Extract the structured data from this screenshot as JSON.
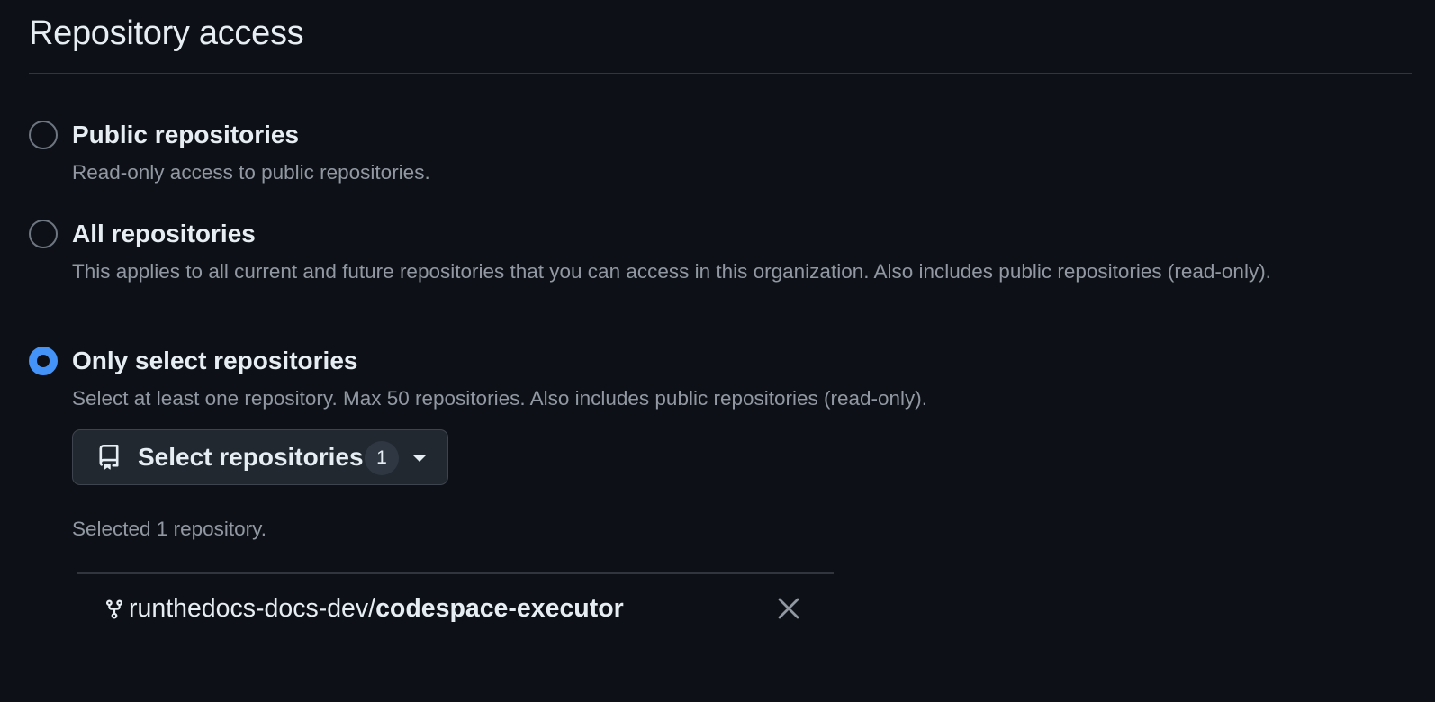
{
  "page": {
    "title": "Repository access"
  },
  "options": [
    {
      "label": "Public repositories",
      "description": "Read-only access to public repositories.",
      "checked": false
    },
    {
      "label": "All repositories",
      "description": "This applies to all current and future repositories that you can access in this organization. Also includes public repositories (read-only).",
      "checked": false
    },
    {
      "label": "Only select repositories",
      "description": "Select at least one repository. Max 50 repositories. Also includes public repositories (read-only).",
      "checked": true
    }
  ],
  "select_button": {
    "label": "Select repositories",
    "count": "1",
    "icon": "repo-icon"
  },
  "selection": {
    "summary": "Selected 1 repository.",
    "repositories": [
      {
        "owner": "runthedocs-docs-dev",
        "separator": "/",
        "name": "codespace-executor",
        "icon": "repo-forked-icon"
      }
    ]
  },
  "colors": {
    "background": "#0d1117",
    "accent": "#4493f8",
    "text_primary": "#e6edf3",
    "text_muted": "#9198a1",
    "border": "#30363d"
  }
}
